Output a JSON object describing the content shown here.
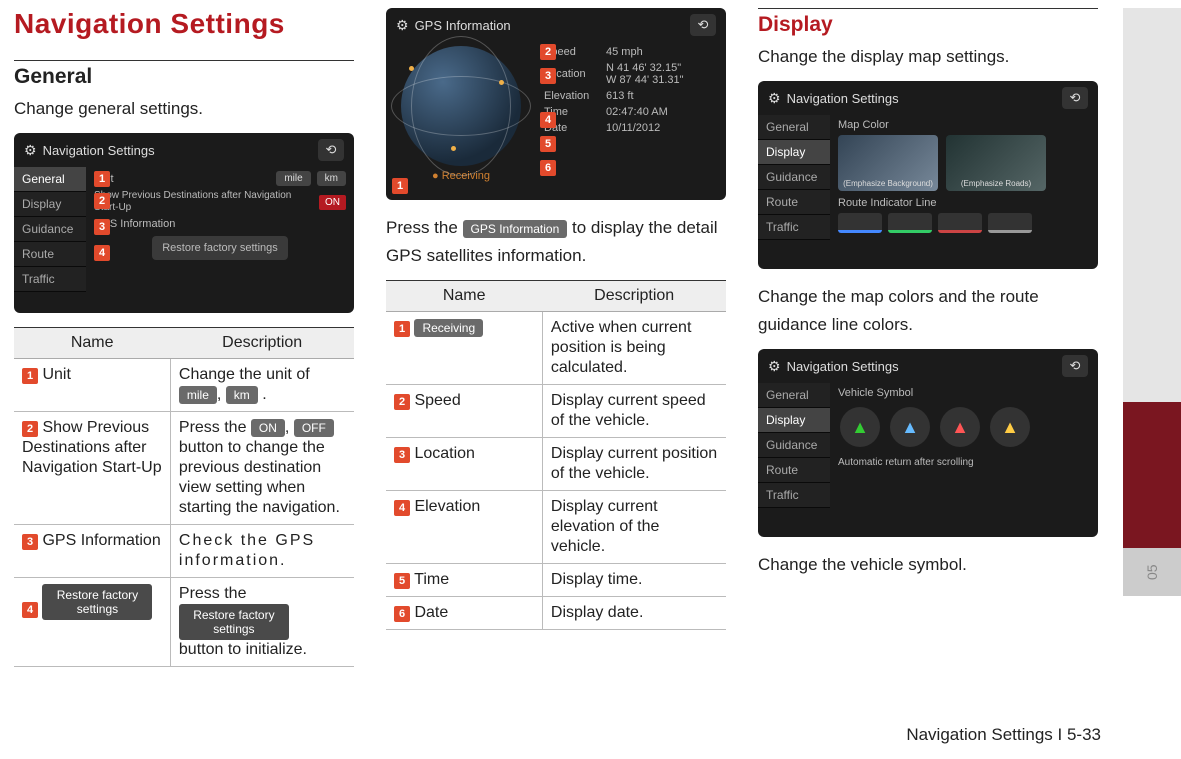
{
  "title": "Navigation Settings",
  "footer": "Navigation Settings I 5-33",
  "sideTabNum": "05",
  "col1": {
    "heading": "General",
    "desc": "Change general settings.",
    "screenshot": {
      "header": "Navigation Settings",
      "menu": [
        "General",
        "Display",
        "Guidance",
        "Route",
        "Traffic"
      ],
      "rows": {
        "unit_label": "Unit",
        "unit_mile": "mile",
        "unit_km": "km",
        "prev": "Show Previous Destinations after Navigation Start-Up",
        "prev_on": "ON",
        "gps": "GPS Information",
        "restore": "Restore factory settings"
      }
    },
    "tableHead": {
      "name": "Name",
      "desc": "Description"
    },
    "table": [
      {
        "num": "1",
        "name": "Unit",
        "desc_a": "Change the unit of ",
        "chip1": "mile",
        "mid": ", ",
        "chip2": "km",
        "desc_b": " ."
      },
      {
        "num": "2",
        "name": "Show Previous Destinations after Navigation Start-Up",
        "desc_a": "Press the ",
        "chip1": "ON",
        "mid": ", ",
        "chip2": "OFF",
        "desc_b": " button to change the previous destination view setting when starting the navigation."
      },
      {
        "num": "3",
        "name": "GPS Information",
        "desc": "Check the GPS information."
      },
      {
        "num": "4",
        "name_chip": "Restore factory settings",
        "desc_a": "Press the ",
        "chip1": "Restore factory settings",
        "desc_b": " button to initialize."
      }
    ]
  },
  "col2": {
    "screenshot": {
      "header": "GPS Information",
      "receiving": "Receiving",
      "rows": [
        {
          "k": "Speed",
          "v": "45 mph"
        },
        {
          "k": "Location",
          "v": "N 41 46' 32.15\"\nW 87 44' 31.31\""
        },
        {
          "k": "Elevation",
          "v": "613 ft"
        },
        {
          "k": "Time",
          "v": "02:47:40 AM"
        },
        {
          "k": "Date",
          "v": "10/11/2012"
        }
      ]
    },
    "press_a": "Press the ",
    "press_chip": "GPS Information",
    "press_b": " to display the detail GPS satellites information.",
    "tableHead": {
      "name": "Name",
      "desc": "Description"
    },
    "table": [
      {
        "num": "1",
        "name_chip": "Receiving",
        "desc": "Active when current position is being calculated."
      },
      {
        "num": "2",
        "name": "Speed",
        "desc": "Display current speed of the vehicle."
      },
      {
        "num": "3",
        "name": "Location",
        "desc": "Display current position of the vehicle."
      },
      {
        "num": "4",
        "name": "Elevation",
        "desc": "Display current elevation of the vehicle."
      },
      {
        "num": "5",
        "name": "Time",
        "desc": "Display time."
      },
      {
        "num": "6",
        "name": "Date",
        "desc": "Display date."
      }
    ]
  },
  "col3": {
    "heading": "Display",
    "desc": "Change the display map settings.",
    "ss1": {
      "header": "Navigation Settings",
      "menu": [
        "General",
        "Display",
        "Guidance",
        "Route",
        "Traffic"
      ],
      "mapcolor": "Map Color",
      "btn1": "(Emphasize Background)",
      "btn2": "(Emphasize Roads)",
      "routeind": "Route Indicator Line"
    },
    "text2": "Change the map colors and the route guidance line colors.",
    "ss2": {
      "header": "Navigation Settings",
      "menu": [
        "General",
        "Display",
        "Guidance",
        "Route",
        "Traffic"
      ],
      "vsym": "Vehicle Symbol",
      "auto": "Automatic return after scrolling"
    },
    "text3": "Change the vehicle symbol."
  }
}
